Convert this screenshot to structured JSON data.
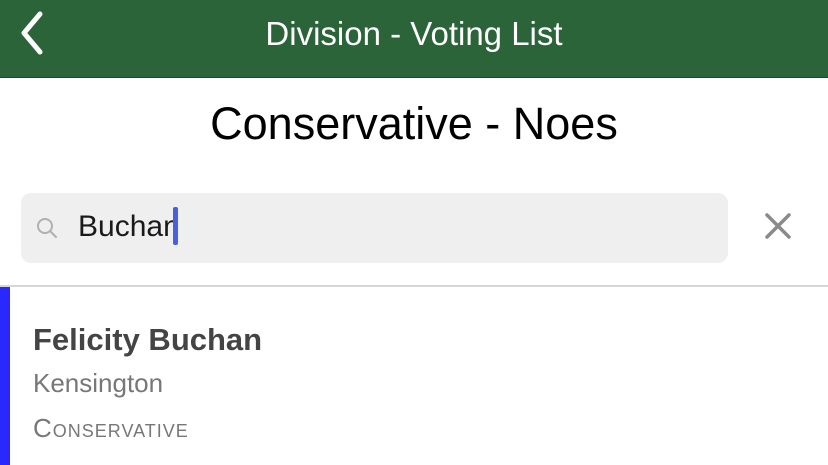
{
  "navbar": {
    "title": "Division - Voting List",
    "back_icon": "chevron-left-icon",
    "background": "#2b6439"
  },
  "page": {
    "title": "Conservative - Noes"
  },
  "search": {
    "value": "Buchan",
    "search_icon": "search-icon",
    "clear_icon": "close-icon"
  },
  "results": [
    {
      "name": "Felicity Buchan",
      "constituency": "Kensington",
      "party": "Conservative",
      "party_color": "#2828ff"
    }
  ]
}
